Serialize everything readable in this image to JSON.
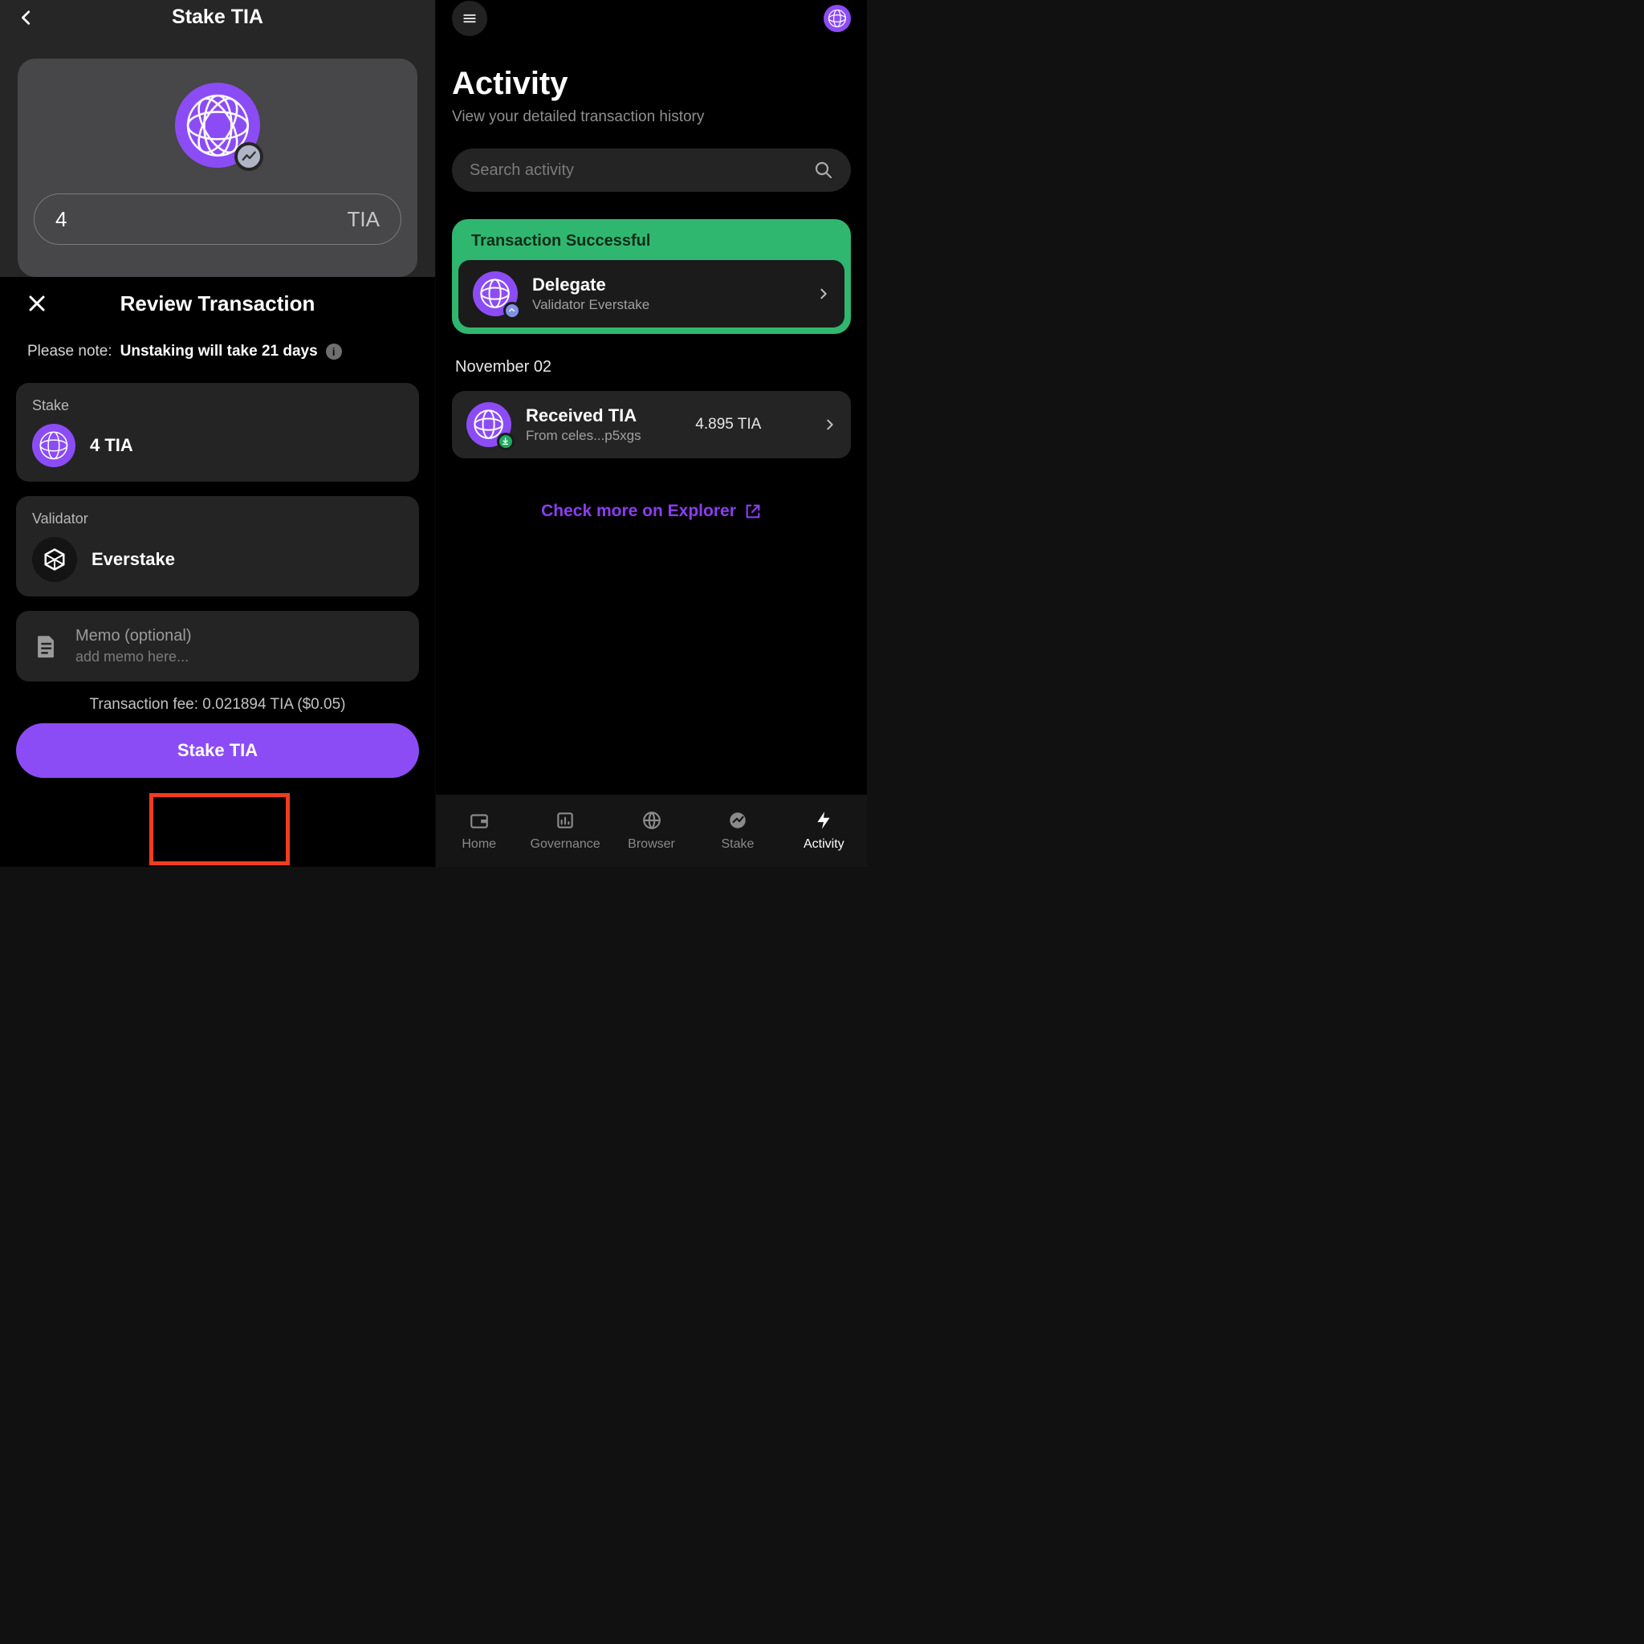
{
  "left": {
    "header_title": "Stake TIA",
    "amount_value": "4",
    "amount_ticker": "TIA",
    "sheet": {
      "title": "Review Transaction",
      "note_prefix": "Please note:",
      "note_bold": "Unstaking will take 21 days",
      "stake_label": "Stake",
      "stake_value": "4 TIA",
      "validator_label": "Validator",
      "validator_name": "Everstake",
      "memo_title": "Memo (optional)",
      "memo_placeholder": "add memo here...",
      "fee_line": "Transaction fee: 0.021894 TIA ($0.05)",
      "cta": "Stake TIA"
    }
  },
  "right": {
    "title": "Activity",
    "subtitle": "View your detailed transaction history",
    "search_placeholder": "Search activity",
    "success_banner": "Transaction Successful",
    "delegate": {
      "title": "Delegate",
      "subtitle": "Validator Everstake"
    },
    "date_header": "November 02",
    "received": {
      "title": "Received TIA",
      "subtitle": "From celes...p5xgs",
      "amount": "4.895 TIA"
    },
    "explorer_link": "Check more on Explorer",
    "nav": {
      "home": "Home",
      "governance": "Governance",
      "browser": "Browser",
      "stake": "Stake",
      "activity": "Activity"
    }
  }
}
